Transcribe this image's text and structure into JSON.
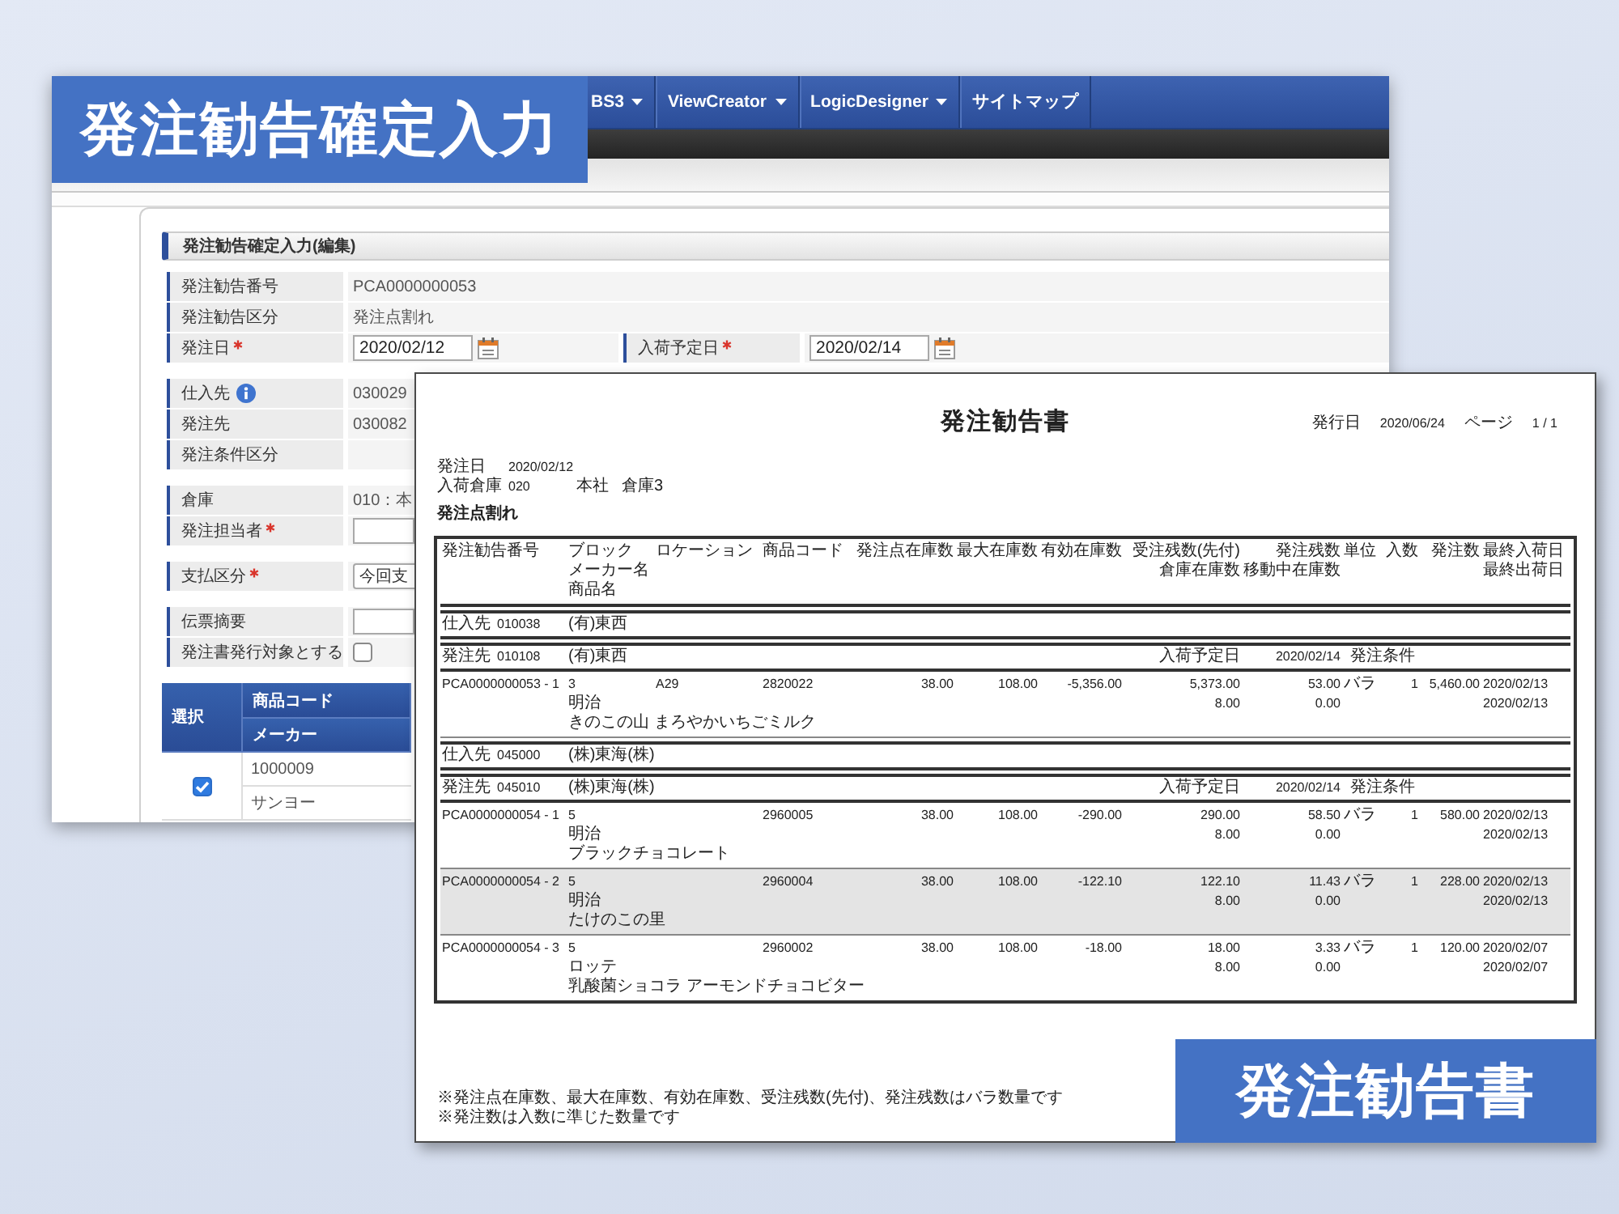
{
  "header_label": {
    "text": "発注勧告確定入力"
  },
  "app_window": {
    "nav": [
      {
        "label": "BS3",
        "caret": true
      },
      {
        "label": "ViewCreator",
        "caret": true
      },
      {
        "label": "LogicDesigner",
        "caret": true
      },
      {
        "label": "サイトマップ",
        "caret": false
      }
    ],
    "section_title": "発注勧告確定入力(編集)",
    "groups": [
      {
        "rows": [
          {
            "fields": [
              {
                "label": "発注勧告番号",
                "required": false,
                "info": false,
                "kind": "text",
                "value": "PCA0000000053"
              }
            ]
          },
          {
            "fields": [
              {
                "label": "発注勧告区分",
                "required": false,
                "info": false,
                "kind": "text",
                "value": "発注点割れ"
              }
            ]
          },
          {
            "fields": [
              {
                "label": "発注日",
                "required": true,
                "info": false,
                "kind": "date",
                "value": "2020/02/12"
              },
              {
                "label": "入荷予定日",
                "required": true,
                "info": false,
                "kind": "date",
                "value": "2020/02/14"
              }
            ]
          }
        ]
      },
      {
        "rows": [
          {
            "fields": [
              {
                "label": "仕入先",
                "required": false,
                "info": true,
                "kind": "text",
                "value": "030029"
              }
            ]
          },
          {
            "fields": [
              {
                "label": "発注先",
                "required": false,
                "info": false,
                "kind": "text",
                "value": "030082"
              }
            ]
          },
          {
            "fields": [
              {
                "label": "発注条件区分",
                "required": false,
                "info": false,
                "kind": "empty"
              }
            ]
          }
        ]
      },
      {
        "rows": [
          {
            "fields": [
              {
                "label": "倉庫",
                "required": false,
                "info": false,
                "kind": "text",
                "value": "010：本"
              }
            ]
          },
          {
            "fields": [
              {
                "label": "発注担当者",
                "required": true,
                "info": false,
                "kind": "input"
              }
            ]
          }
        ]
      },
      {
        "rows": [
          {
            "fields": [
              {
                "label": "支払区分",
                "required": true,
                "info": false,
                "kind": "select",
                "value": "今回支"
              }
            ]
          }
        ]
      },
      {
        "rows": [
          {
            "fields": [
              {
                "label": "伝票摘要",
                "required": false,
                "info": false,
                "kind": "input"
              }
            ]
          },
          {
            "fields": [
              {
                "label": "発注書発行対象とする",
                "required": false,
                "info": false,
                "kind": "checkbox",
                "checked": false
              }
            ]
          }
        ]
      }
    ],
    "table": {
      "select_header": "選択",
      "headers": [
        "商品コード",
        "メーカー"
      ],
      "rows": [
        {
          "checked": true,
          "cells": [
            "1000009",
            "サンヨー"
          ]
        }
      ]
    }
  },
  "document": {
    "title": "発注勧告書",
    "issued_label": "発行日",
    "issued_date": "2020/06/24",
    "page_label": "ページ",
    "page": "1 / 1",
    "meta": [
      {
        "label": "発注日",
        "values": [
          "2020/02/12"
        ]
      },
      {
        "label": "入荷倉庫",
        "values": [
          "020",
          "本社",
          "倉庫3"
        ]
      }
    ],
    "category": "発注点割れ",
    "table": {
      "columns": [
        [
          "発注勧告番号"
        ],
        [
          "ブロック",
          "メーカー名",
          "商品名"
        ],
        [
          "ロケーション"
        ],
        [
          "商品コード"
        ],
        [
          "発注点在庫数"
        ],
        [
          "最大在庫数"
        ],
        [
          "有効在庫数"
        ],
        [
          "受注残数(先付)",
          "倉庫在庫数"
        ],
        [
          "発注残数",
          "移動中在庫数"
        ],
        [
          "単位"
        ],
        [
          "入数"
        ],
        [
          "発注数"
        ],
        [
          "最終入荷日",
          "最終出荷日"
        ]
      ],
      "sections": [
        {
          "kind": "band",
          "label": "仕入先",
          "code": "010038",
          "name": "(有)東西"
        },
        {
          "kind": "band",
          "label": "発注先",
          "code": "010108",
          "name": "(有)東西",
          "due_label": "入荷予定日",
          "due_date": "2020/02/14",
          "terms_label": "発注条件"
        },
        {
          "kind": "item",
          "highlighted": false,
          "no": "PCA0000000053 - 1",
          "block": "3",
          "location": "A29",
          "code": "2820022",
          "reorder": "38.00",
          "max": "108.00",
          "available": "-5,356.00",
          "backorder": "5,373.00",
          "on_order": "53.00",
          "unit": "バラ",
          "per_case": "1",
          "qty": "5,460.00",
          "last_in": "2020/02/13",
          "maker": "明治",
          "stock": "8.00",
          "transit": "0.00",
          "last_out": "2020/02/13",
          "product": "きのこの山 まろやかいちごミルク"
        },
        {
          "kind": "band",
          "label": "仕入先",
          "code": "045000",
          "name": "(株)東海(株)"
        },
        {
          "kind": "band",
          "label": "発注先",
          "code": "045010",
          "name": "(株)東海(株)",
          "due_label": "入荷予定日",
          "due_date": "2020/02/14",
          "terms_label": "発注条件"
        },
        {
          "kind": "item",
          "highlighted": false,
          "no": "PCA0000000054 - 1",
          "block": "5",
          "code": "2960005",
          "reorder": "38.00",
          "max": "108.00",
          "available": "-290.00",
          "backorder": "290.00",
          "on_order": "58.50",
          "unit": "バラ",
          "per_case": "1",
          "qty": "580.00",
          "last_in": "2020/02/13",
          "maker": "明治",
          "stock": "8.00",
          "transit": "0.00",
          "last_out": "2020/02/13",
          "product": "ブラックチョコレート"
        },
        {
          "kind": "item",
          "highlighted": true,
          "no": "PCA0000000054 - 2",
          "block": "5",
          "code": "2960004",
          "reorder": "38.00",
          "max": "108.00",
          "available": "-122.10",
          "backorder": "122.10",
          "on_order": "11.43",
          "unit": "バラ",
          "per_case": "1",
          "qty": "228.00",
          "last_in": "2020/02/13",
          "maker": "明治",
          "stock": "8.00",
          "transit": "0.00",
          "last_out": "2020/02/13",
          "product": "たけのこの里"
        },
        {
          "kind": "item",
          "highlighted": false,
          "no": "PCA0000000054 - 3",
          "block": "5",
          "code": "2960002",
          "reorder": "38.00",
          "max": "108.00",
          "available": "-18.00",
          "backorder": "18.00",
          "on_order": "3.33",
          "unit": "バラ",
          "per_case": "1",
          "qty": "120.00",
          "last_in": "2020/02/07",
          "maker": "ロッテ",
          "stock": "8.00",
          "transit": "0.00",
          "last_out": "2020/02/07",
          "product": "乳酸菌ショコラ アーモンドチョコビター"
        }
      ]
    },
    "notes": [
      "※発注点在庫数、最大在庫数、有効在庫数、受注残数(先付)、発注残数はバラ数量です",
      "※発注数は入数に準じた数量です"
    ]
  },
  "footer_label": {
    "text": "発注勧告書"
  }
}
